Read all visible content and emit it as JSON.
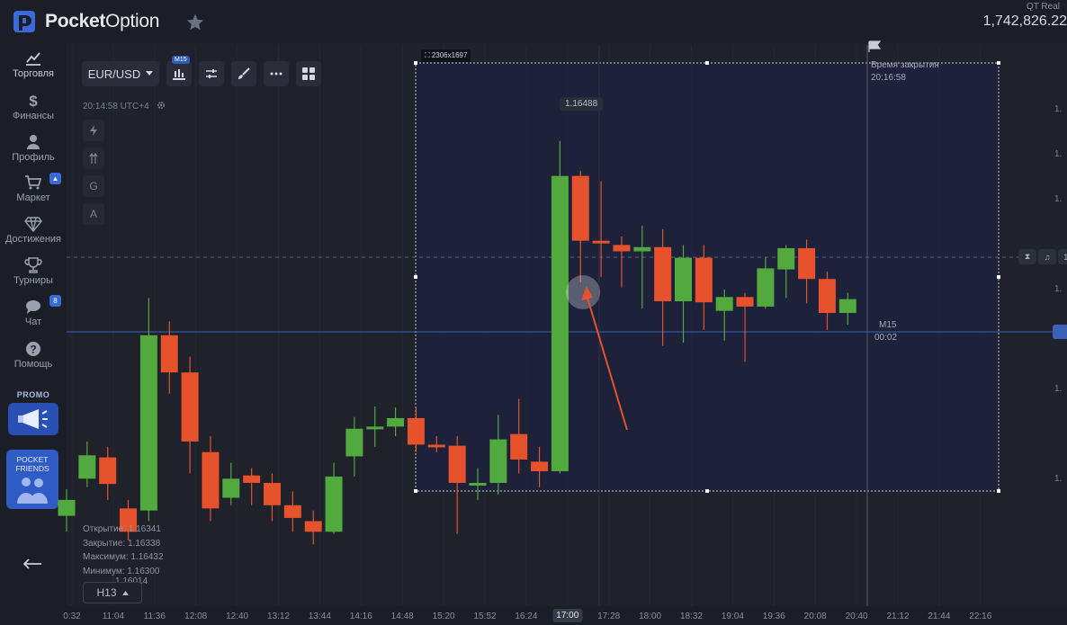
{
  "app": {
    "logo_text_bold": "Pocket",
    "logo_text_light": "Option"
  },
  "account": {
    "type": "QT Real",
    "balance": "1,742,826.22"
  },
  "sidebar": {
    "items": [
      {
        "label": "Торговля",
        "icon": "chart-line-icon"
      },
      {
        "label": "Финансы",
        "icon": "dollar-icon"
      },
      {
        "label": "Профиль",
        "icon": "user-icon"
      },
      {
        "label": "Маркет",
        "icon": "cart-icon"
      },
      {
        "label": "Достижения",
        "icon": "diamond-icon"
      },
      {
        "label": "Турниры",
        "icon": "trophy-icon"
      },
      {
        "label": "Чат",
        "icon": "chat-icon",
        "badge": "8"
      },
      {
        "label": "Помощь",
        "icon": "help-icon"
      }
    ],
    "promo_label": "PROMO",
    "friends_label_1": "POCKET",
    "friends_label_2": "FRIENDS"
  },
  "toolbar": {
    "pair": "EUR/USD",
    "timeframe_badge": "M15",
    "server_time": "20:14:58 UTC+4",
    "side_tools": [
      "G",
      "A"
    ]
  },
  "ohlc": {
    "open_label": "Открытие:",
    "open": "1.16341",
    "close_label": "Закрытие:",
    "close": "1.16338",
    "max_label": "Максимум:",
    "max": "1.16432",
    "min_label": "Минимум:",
    "min": "1.16300",
    "extra": "1.16014"
  },
  "timeframe_select": "H13",
  "selection": {
    "size_label": "2306x1697"
  },
  "closing": {
    "label": "Время закрытия",
    "time": "20:16:58"
  },
  "price_tag": "1.16488",
  "marker": {
    "tf": "M15",
    "countdown": "00:02"
  },
  "yaxis_ticks": [
    "1.",
    "1.",
    "1.",
    "1.",
    "1.",
    "1.",
    "1."
  ],
  "xaxis": {
    "ticks": [
      "0:32",
      "11:04",
      "11:36",
      "12:08",
      "12:40",
      "13:12",
      "13:44",
      "14:16",
      "14:48",
      "15:20",
      "15:52",
      "16:24",
      "17:00",
      "17:28",
      "18:00",
      "18:32",
      "19:04",
      "19:36",
      "20:08",
      "20:40",
      "21:12",
      "21:44",
      "22:16"
    ],
    "current": "17:00"
  },
  "colors": {
    "up": "#52a93e",
    "down": "#e5522c",
    "accent": "#3b61b9",
    "bg": "#1f212b"
  },
  "chart_data": {
    "type": "candlestick",
    "candles": [
      {
        "o": 1.16335,
        "c": 1.1635,
        "h": 1.1636,
        "l": 1.1632
      },
      {
        "o": 1.1637,
        "c": 1.16392,
        "h": 1.16405,
        "l": 1.16362
      },
      {
        "o": 1.1639,
        "c": 1.16365,
        "h": 1.164,
        "l": 1.1635
      },
      {
        "o": 1.16342,
        "c": 1.1632,
        "h": 1.1635,
        "l": 1.16312
      },
      {
        "o": 1.1634,
        "c": 1.16505,
        "h": 1.1654,
        "l": 1.1633
      },
      {
        "o": 1.16505,
        "c": 1.1647,
        "h": 1.16518,
        "l": 1.1645
      },
      {
        "o": 1.1647,
        "c": 1.16405,
        "h": 1.16485,
        "l": 1.16375
      },
      {
        "o": 1.16395,
        "c": 1.16342,
        "h": 1.1641,
        "l": 1.1633
      },
      {
        "o": 1.16352,
        "c": 1.1637,
        "h": 1.16385,
        "l": 1.16345
      },
      {
        "o": 1.16373,
        "c": 1.16366,
        "h": 1.1638,
        "l": 1.16345
      },
      {
        "o": 1.16366,
        "c": 1.16345,
        "h": 1.16375,
        "l": 1.1633
      },
      {
        "o": 1.16345,
        "c": 1.16333,
        "h": 1.16358,
        "l": 1.1632
      },
      {
        "o": 1.1633,
        "c": 1.1632,
        "h": 1.1634,
        "l": 1.16308
      },
      {
        "o": 1.1632,
        "c": 1.16372,
        "h": 1.16385,
        "l": 1.16318
      },
      {
        "o": 1.16391,
        "c": 1.16417,
        "h": 1.16428,
        "l": 1.16372
      },
      {
        "o": 1.16417,
        "c": 1.16419,
        "h": 1.16438,
        "l": 1.164
      },
      {
        "o": 1.16419,
        "c": 1.16427,
        "h": 1.16437,
        "l": 1.1641
      },
      {
        "o": 1.16427,
        "c": 1.16402,
        "h": 1.16437,
        "l": 1.16395
      },
      {
        "o": 1.16402,
        "c": 1.16401,
        "h": 1.1641,
        "l": 1.16395
      },
      {
        "o": 1.16401,
        "c": 1.16366,
        "h": 1.1641,
        "l": 1.16318
      },
      {
        "o": 1.16364,
        "c": 1.16366,
        "h": 1.1638,
        "l": 1.1635
      },
      {
        "o": 1.16366,
        "c": 1.16407,
        "h": 1.1643,
        "l": 1.16355
      },
      {
        "o": 1.16412,
        "c": 1.16388,
        "h": 1.16445,
        "l": 1.16375
      },
      {
        "o": 1.16386,
        "c": 1.16377,
        "h": 1.164,
        "l": 1.16362
      },
      {
        "o": 1.16377,
        "c": 1.16655,
        "h": 1.16688,
        "l": 1.16375
      },
      {
        "o": 1.16655,
        "c": 1.16594,
        "h": 1.1666,
        "l": 1.16555
      },
      {
        "o": 1.16594,
        "c": 1.16592,
        "h": 1.1665,
        "l": 1.1656
      },
      {
        "o": 1.1659,
        "c": 1.16584,
        "h": 1.16598,
        "l": 1.1655
      },
      {
        "o": 1.16584,
        "c": 1.16588,
        "h": 1.16608,
        "l": 1.1653
      },
      {
        "o": 1.16588,
        "c": 1.16537,
        "h": 1.16605,
        "l": 1.16495
      },
      {
        "o": 1.16537,
        "c": 1.16578,
        "h": 1.1659,
        "l": 1.16498
      },
      {
        "o": 1.16578,
        "c": 1.16536,
        "h": 1.1659,
        "l": 1.1651
      },
      {
        "o": 1.16528,
        "c": 1.16541,
        "h": 1.16548,
        "l": 1.165
      },
      {
        "o": 1.16541,
        "c": 1.16532,
        "h": 1.16545,
        "l": 1.1648
      },
      {
        "o": 1.16532,
        "c": 1.16568,
        "h": 1.16578,
        "l": 1.1653
      },
      {
        "o": 1.16567,
        "c": 1.16587,
        "h": 1.1659,
        "l": 1.1654
      },
      {
        "o": 1.16587,
        "c": 1.16558,
        "h": 1.16595,
        "l": 1.16535
      },
      {
        "o": 1.16558,
        "c": 1.16526,
        "h": 1.16565,
        "l": 1.1651
      },
      {
        "o": 1.16526,
        "c": 1.16539,
        "h": 1.16545,
        "l": 1.16515
      }
    ],
    "ylim": [
      1.1625,
      1.1678
    ]
  }
}
